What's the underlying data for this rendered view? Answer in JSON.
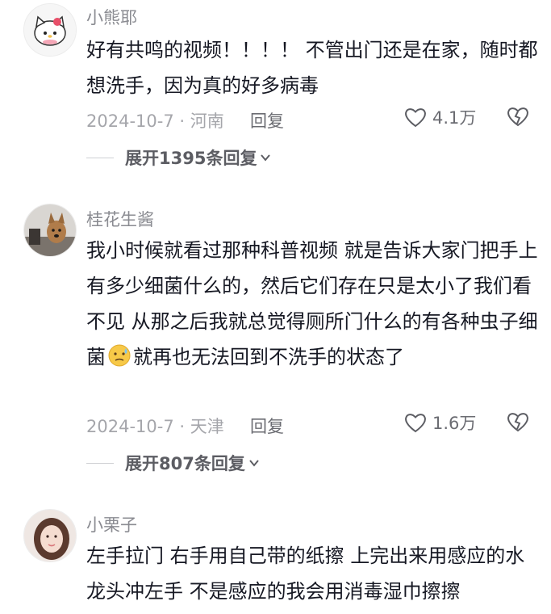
{
  "comments": [
    {
      "username": "小熊耶",
      "text": "好有共鸣的视频！！！！ 不管出门还是在家，随时都想洗手，因为真的好多病毒",
      "date_location": "2024-10-7 · 河南",
      "reply_label": "回复",
      "likes": "4.1万",
      "expand_label": "展开1395条回复",
      "avatar_icon": "hello-kitty-avatar"
    },
    {
      "username": "桂花生酱",
      "text_before_emoji": "我小时候就看过那种科普视频 就是告诉大家门把手上有多少细菌什么的，然后它们存在只是太小了我们看不见 从那之后我就总觉得厕所门什么的有各种虫子细菌",
      "text_after_emoji": "就再也无法回到不洗手的状态了",
      "emoji_icon": "sweat-face-emoji",
      "date_location": "2024-10-7 · 天津",
      "reply_label": "回复",
      "likes": "1.6万",
      "expand_label": "展开807条回复",
      "avatar_icon": "dog-photo-avatar"
    },
    {
      "username": "小栗子",
      "text": "左手拉门 右手用自己带的纸擦 上完出来用感应的水龙头冲左手 不是感应的我会用消毒湿巾擦擦",
      "avatar_icon": "girl-photo-avatar"
    }
  ],
  "colors": {
    "username": "#8a8b91",
    "text": "#161823",
    "meta": "#a5a6ab"
  }
}
